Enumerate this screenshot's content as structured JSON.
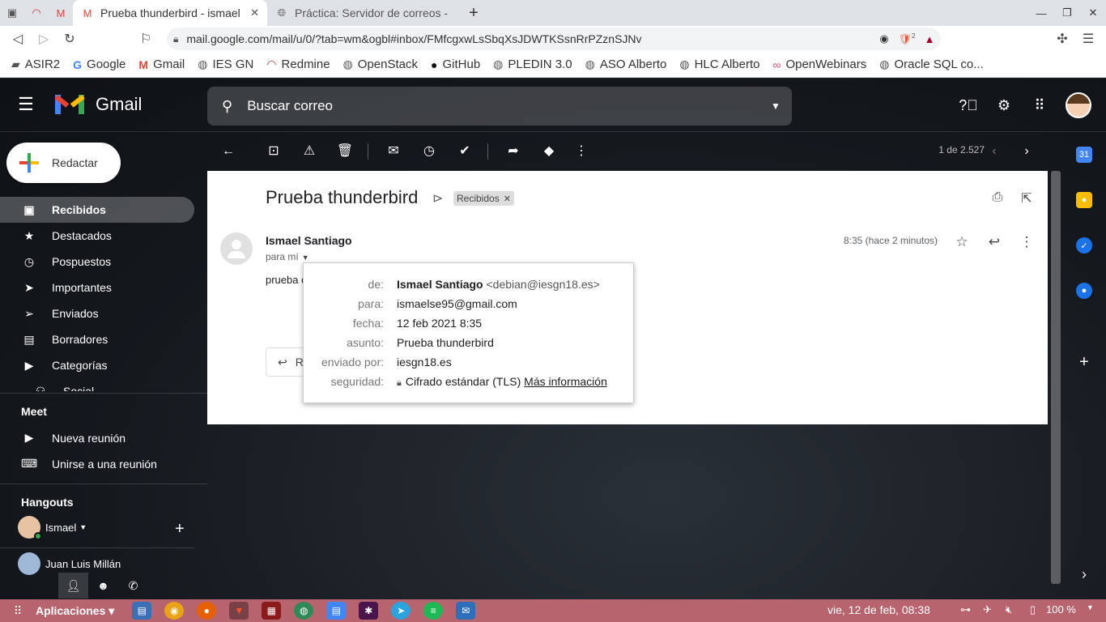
{
  "browser": {
    "tabs": [
      {
        "title": "Prueba thunderbird - ismael",
        "active": true
      },
      {
        "title": "Práctica: Servidor de correos -",
        "active": false
      }
    ],
    "url": "mail.google.com/mail/u/0/?tab=wm&ogbl#inbox/FMfcgxwLsSbqXsJDWTKSsnRrPZznSJNv",
    "brave_badge": "2",
    "bookmarks": [
      {
        "label": "ASIR2",
        "icon": "folder-icon"
      },
      {
        "label": "Google",
        "icon": "google-icon"
      },
      {
        "label": "Gmail",
        "icon": "gmail-icon"
      },
      {
        "label": "IES GN",
        "icon": "globe-icon"
      },
      {
        "label": "Redmine",
        "icon": "redmine-icon"
      },
      {
        "label": "OpenStack",
        "icon": "globe-icon"
      },
      {
        "label": "GitHub",
        "icon": "github-icon"
      },
      {
        "label": "PLEDIN 3.0",
        "icon": "globe-icon"
      },
      {
        "label": "ASO Alberto",
        "icon": "globe-icon"
      },
      {
        "label": "HLC Alberto",
        "icon": "globe-icon"
      },
      {
        "label": "OpenWebinars",
        "icon": "openwebinars-icon"
      },
      {
        "label": "Oracle SQL co...",
        "icon": "globe-icon"
      }
    ]
  },
  "gmail": {
    "logo_text": "Gmail",
    "search_placeholder": "Buscar correo",
    "compose_label": "Redactar",
    "nav": [
      {
        "label": "Recibidos",
        "icon": "inbox-icon",
        "active": true
      },
      {
        "label": "Destacados",
        "icon": "star-icon"
      },
      {
        "label": "Pospuestos",
        "icon": "clock-icon"
      },
      {
        "label": "Importantes",
        "icon": "important-icon"
      },
      {
        "label": "Enviados",
        "icon": "send-icon"
      },
      {
        "label": "Borradores",
        "icon": "draft-icon"
      },
      {
        "label": "Categorías",
        "icon": "label-icon"
      },
      {
        "label": "Social",
        "icon": "social-icon"
      }
    ],
    "meet": {
      "title": "Meet",
      "new_meeting": "Nueva reunión",
      "join_meeting": "Unirse a una reunión"
    },
    "hangouts": {
      "title": "Hangouts",
      "user": "Ismael",
      "contact": "Juan Luis Millán"
    },
    "pager": "1 de 2.527",
    "message": {
      "subject": "Prueba thunderbird",
      "label": "Recibidos",
      "sender": "Ismael Santiago",
      "to": "para mí",
      "time": "8:35 (hace 2 minutos)",
      "body": "prueba d",
      "reply_label": "R"
    },
    "details": {
      "from_key": "de:",
      "from_name": "Ismael Santiago",
      "from_email": "<debian@iesgn18.es>",
      "to_key": "para:",
      "to_value": "ismaelse95@gmail.com",
      "date_key": "fecha:",
      "date_value": "12 feb 2021 8:35",
      "subject_key": "asunto:",
      "subject_value": "Prueba thunderbird",
      "sentby_key": "enviado por:",
      "sentby_value": "iesgn18.es",
      "security_key": "seguridad:",
      "security_value": "Cifrado estándar (TLS)",
      "security_link": "Más información"
    }
  },
  "taskbar": {
    "apps_label": "Aplicaciones",
    "clock": "vie, 12 de feb, 08:38",
    "battery": "100 %"
  },
  "colors": {
    "gmail_red": "#ea4335",
    "gmail_blue": "#4285f4",
    "gmail_green": "#34a853",
    "gmail_yellow": "#fbbc04",
    "taskbar": "#b8646f"
  }
}
